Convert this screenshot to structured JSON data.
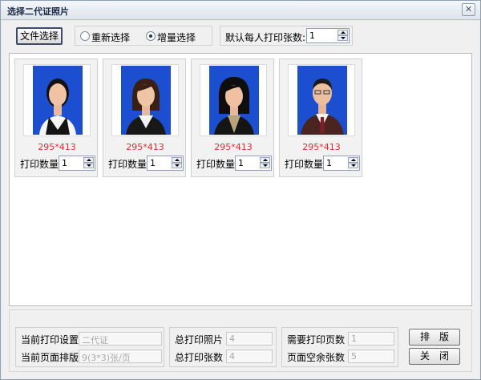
{
  "window": {
    "title": "选择二代证照片",
    "close_glyph": "✕"
  },
  "toolbar": {
    "file_select_label": "文件选择",
    "radio_reselect_label": "重新选择",
    "radio_incremental_label": "增量选择",
    "selected_mode": "incremental",
    "default_copies_label": "默认每人打印张数:",
    "default_copies_value": "1"
  },
  "photos": [
    {
      "size": "295*413",
      "qty_label": "打印数量",
      "qty_value": "1"
    },
    {
      "size": "295*413",
      "qty_label": "打印数量",
      "qty_value": "1"
    },
    {
      "size": "295*413",
      "qty_label": "打印数量",
      "qty_value": "1"
    },
    {
      "size": "295*413",
      "qty_label": "打印数量",
      "qty_value": "1"
    }
  ],
  "footer": {
    "current_print_setting_label": "当前打印设置",
    "current_print_setting_value": "二代证",
    "current_page_layout_label": "当前页面排版",
    "current_page_layout_value": "9(3*3)张/页",
    "total_photos_label": "总打印照片",
    "total_photos_value": "4",
    "total_sheets_label": "总打印张数",
    "total_sheets_value": "4",
    "pages_needed_label": "需要打印页数",
    "pages_needed_value": "1",
    "blank_sheets_label": "页面空余张数",
    "blank_sheets_value": "5",
    "layout_button_label": "排　版",
    "close_button_label": "关　闭"
  },
  "colors": {
    "photo_background": "#1b4fd0",
    "size_text": "#e03030"
  }
}
